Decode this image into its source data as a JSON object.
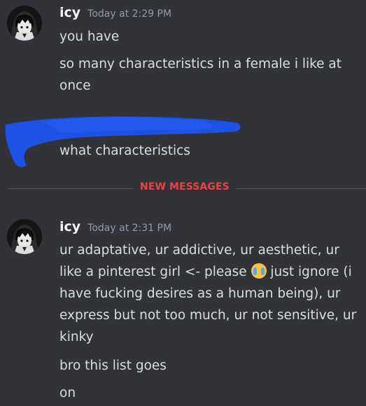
{
  "messages": [
    {
      "author": "icy",
      "timestamp": "Today at 2:29 PM",
      "lines": [
        "you have",
        "so many characteristics in a female i like at once"
      ]
    },
    {
      "author": "",
      "timestamp": "",
      "lines": [
        "what characteristics"
      ]
    },
    {
      "author": "icy",
      "timestamp": "Today at 2:31 PM",
      "lines": [
        "ur adaptative, ur addictive, ur aesthetic, ur like a pinterest girl <- please",
        "just ignore (i have fucking desires as a human being), ur express but not too much, ur not sensitive, ur kinky",
        "bro this list goes",
        "on"
      ]
    }
  ],
  "divider": {
    "label": "NEW MESSAGES"
  },
  "icons": {
    "avatar": "anime-girl-avatar",
    "emoji": "loudly-crying-face-emoji",
    "redaction": "blue-scribble-redaction"
  },
  "colors": {
    "background": "#313338",
    "text": "#dbdee1",
    "username": "#f2f3f5",
    "timestamp": "#949ba4",
    "new_messages": "#f23f43",
    "redaction": "#1e52e6"
  }
}
